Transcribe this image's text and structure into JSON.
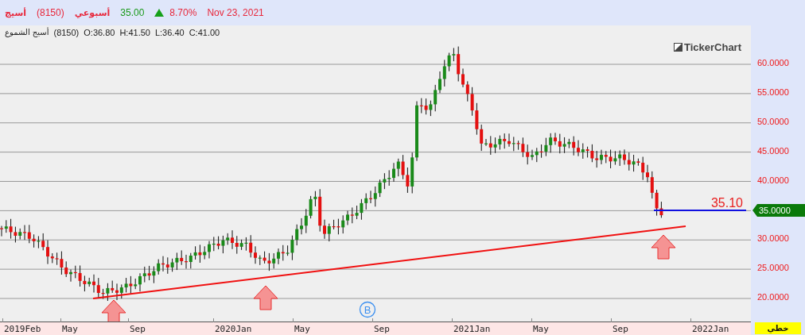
{
  "header": {
    "symbol": "أسيج",
    "code": "(8150)",
    "interval": "أسبوعي",
    "price": "35.00",
    "rising": true,
    "change": "8.70%",
    "date": "Nov 23, 2021"
  },
  "legend": {
    "name": "أسيج الشموع",
    "code": "(8150)",
    "values": [
      "O:36.80",
      "H:41.50",
      "L:36.40",
      "C:41.00"
    ]
  },
  "logo": "TickerChart",
  "chart": {
    "y_labels": [
      "60.0000",
      "55.0000",
      "50.0000",
      "45.0000",
      "40.0000",
      "30.0000",
      "25.0000",
      "20.0000"
    ],
    "price_tag": "35.0000",
    "line_label": "35.10",
    "event_marker": "B",
    "x_labels": [
      "2019Feb",
      "May",
      "Sep",
      "2020Jan",
      "May",
      "Sep",
      "2021Jan",
      "May",
      "Sep",
      "2022Jan"
    ]
  },
  "chart_style": "خطي"
}
